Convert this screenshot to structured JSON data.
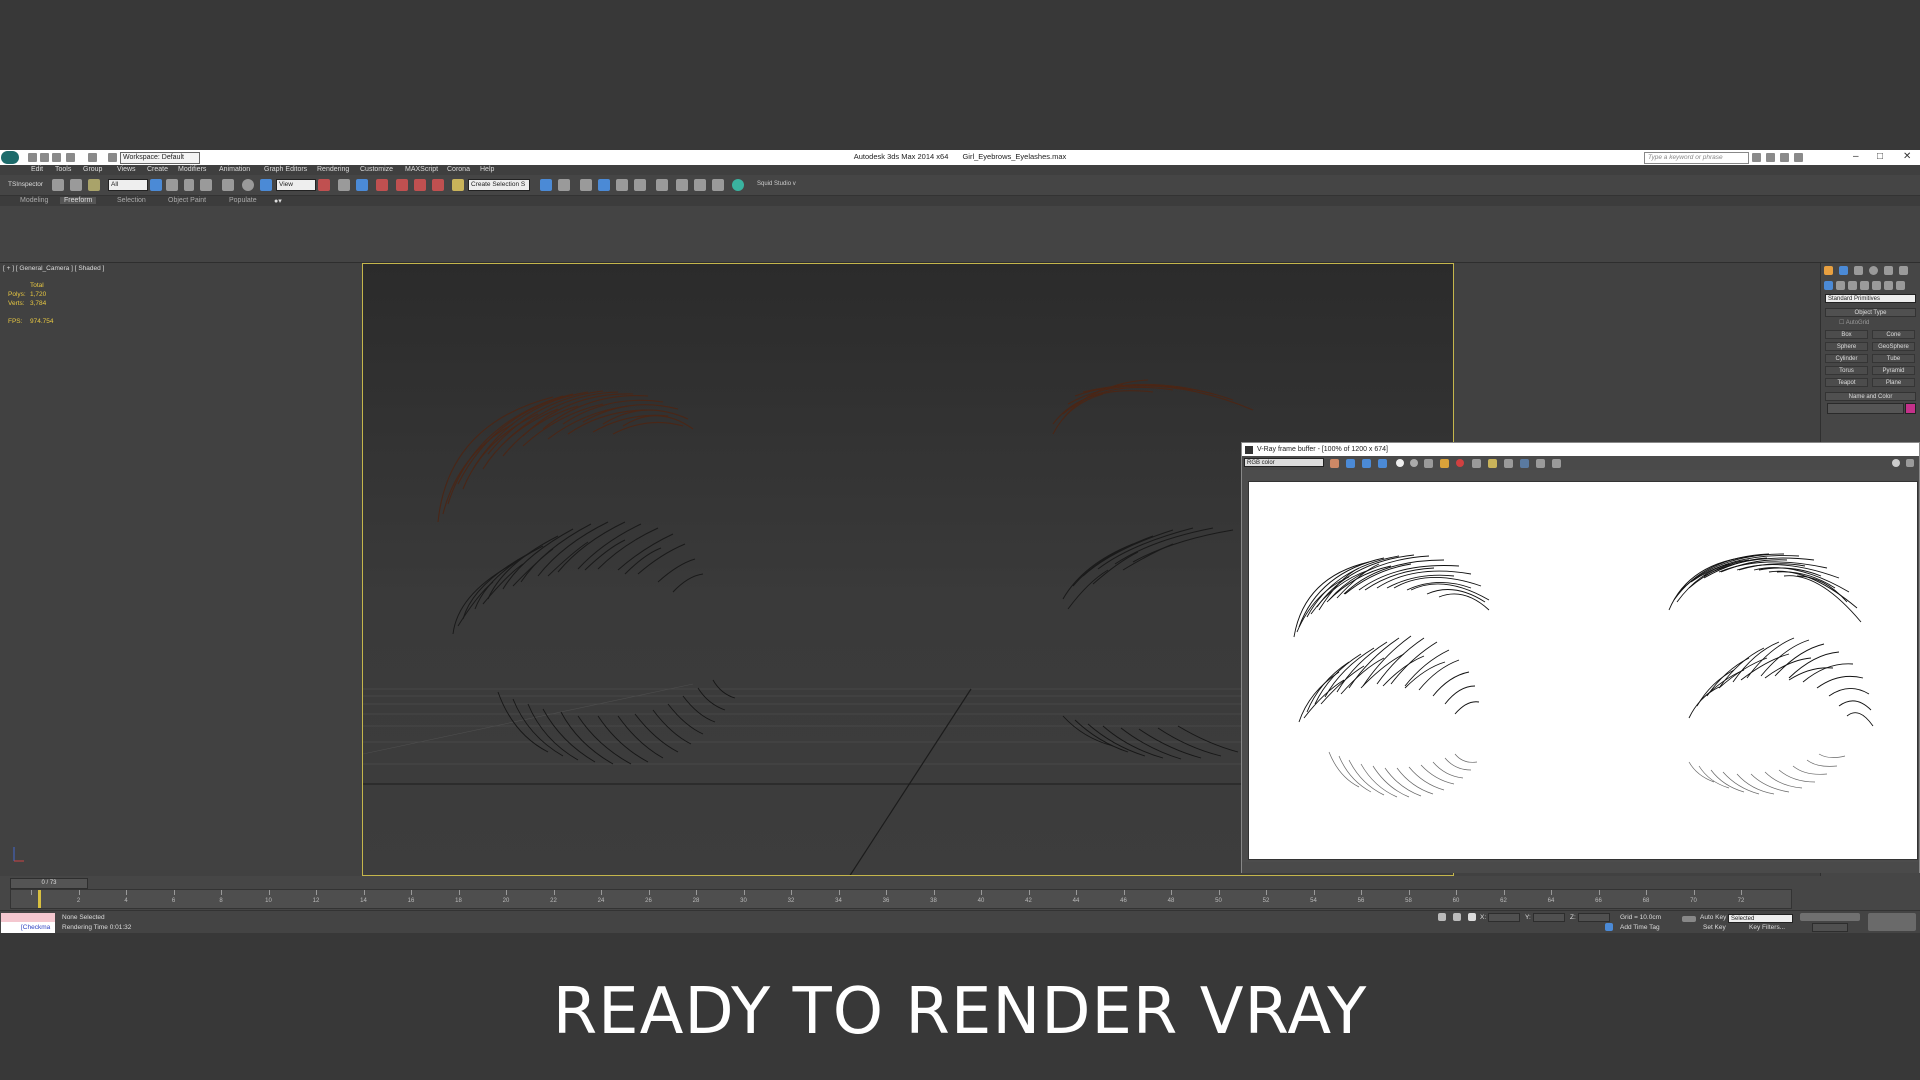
{
  "app": {
    "title": "Autodesk 3ds Max  2014 x64",
    "file": "Girl_Eyebrows_Eyelashes.max",
    "workspace": "Workspace: Default",
    "search_placeholder": "Type a keyword or phrase"
  },
  "menu": [
    "Edit",
    "Tools",
    "Group",
    "Views",
    "Create",
    "Modifiers",
    "Animation",
    "Graph Editors",
    "Rendering",
    "Customize",
    "MAXScript",
    "Corona",
    "Help"
  ],
  "toolbar": {
    "inspector": "TSInspector",
    "filter_selection": "All",
    "ref_coord": "View",
    "named_selection": "Create Selection S",
    "plugin_label": "Squid Studio v"
  },
  "ribbon": {
    "tabs": [
      "Modeling",
      "Freeform",
      "Selection",
      "Object Paint",
      "Populate"
    ],
    "active_tab": "Freeform"
  },
  "viewport": {
    "label": "[ + ] [ General_Camera ] [ Shaded ]",
    "stats": {
      "total_label": "Total",
      "polys_label": "Polys:",
      "polys": "1,720",
      "verts_label": "Verts:",
      "verts": "3,784",
      "fps_label": "FPS:",
      "fps": "974.754"
    }
  },
  "command_panel": {
    "dropdown": "Standard Primitives",
    "object_type_title": "Object Type",
    "autogrid": "AutoGrid",
    "primitives": [
      "Box",
      "Cone",
      "Sphere",
      "GeoSphere",
      "Cylinder",
      "Tube",
      "Torus",
      "Pyramid",
      "Teapot",
      "Plane"
    ],
    "name_color_title": "Name and Color",
    "object_color": "#c4318a"
  },
  "vfb": {
    "title": "V-Ray frame buffer - [100% of 1200 x 674]",
    "channel": "RGB color"
  },
  "timeline": {
    "slider": "0 / 73",
    "ticks": [
      "0",
      "2",
      "4",
      "6",
      "8",
      "10",
      "12",
      "14",
      "16",
      "18",
      "20",
      "22",
      "24",
      "26",
      "28",
      "30",
      "32",
      "34",
      "36",
      "38",
      "40",
      "42",
      "44",
      "46",
      "48",
      "50",
      "52",
      "54",
      "56",
      "58",
      "60",
      "62",
      "64",
      "66",
      "68",
      "70",
      "72"
    ]
  },
  "status": {
    "maxscript_label": "[Checkma",
    "selection": "None Selected",
    "render_time": "Rendering Time  0:01:32",
    "x_label": "X:",
    "y_label": "Y:",
    "z_label": "Z:",
    "grid": "Grid = 10.0cm",
    "add_time_tag": "Add Time Tag",
    "auto_key": "Auto Key",
    "auto_key_mode": "Selected",
    "set_key": "Set Key",
    "key_filters": "Key Filters..."
  },
  "caption": "READY TO RENDER  VRAY"
}
